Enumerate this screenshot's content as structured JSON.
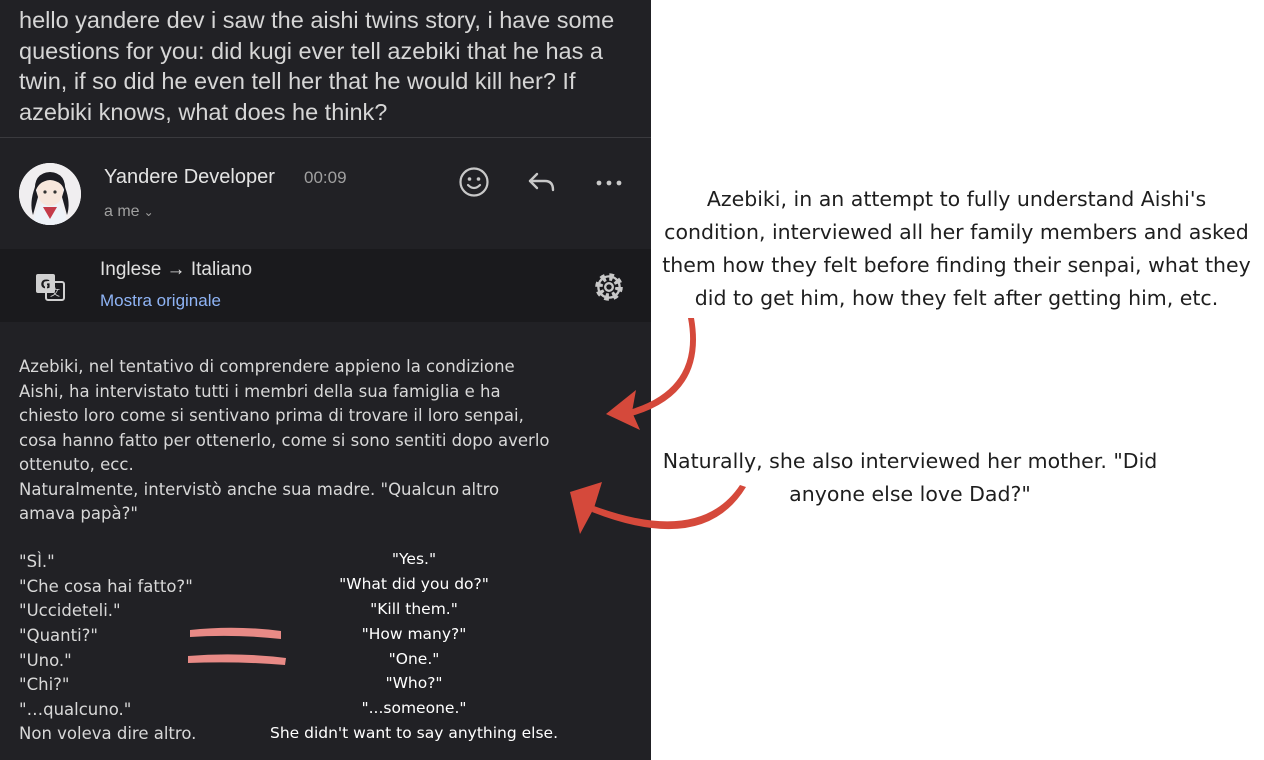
{
  "email": {
    "question": "hello yandere dev i saw the aishi twins story, i have some questions for you: did kugi ever tell azebiki that he has a twin, if so did he even tell her that he would kill her? If azebiki knows, what does he think?",
    "sender": "Yandere Developer",
    "time": "00:09",
    "recipient": "a me",
    "translation_bar": {
      "languages": "Inglese → Italiano",
      "show_original": "Mostra originale"
    },
    "body_paragraph": "Azebiki, nel tentativo di comprendere appieno la condizione\nAishi, ha intervistato tutti i membri della sua famiglia e ha\nchiesto loro come si sentivano prima di trovare il loro senpai,\ncosa hanno fatto per ottenerlo, come si sono sentiti dopo averlo\nottenuto, ecc.\nNaturalmente, intervistò anche sua madre. \"Qualcun altro\namava papà?\"",
    "dialogue_it": [
      "\"SÌ.\"",
      "\"Che cosa hai fatto?\"",
      "\"Uccideteli.\"",
      "\"Quanti?\"",
      "\"Uno.\"",
      "\"Chi?\"",
      "\"…qualcuno.\"",
      "Non voleva dire altro."
    ]
  },
  "overlay": {
    "dialogue_en": [
      "\"Yes.\"",
      "\"What did you do?\"",
      "\"Kill them.\"",
      "\"How many?\"",
      "\"One.\"",
      "\"Who?\"",
      "\"...someone.\"",
      "She didn't want to say anything else."
    ],
    "annotation_1": "Azebiki, in an attempt to fully understand Aishi's condition, interviewed all her family members and asked them how they felt before finding their senpai, what they did to get him, how they felt after getting him, etc.",
    "annotation_2": "Naturally, she also interviewed her mother. \"Did anyone else love Dad?\"",
    "arrow_color": "#d5493b",
    "highlight_color": "#e88a86"
  },
  "icons": [
    "emoji-icon",
    "reply-icon",
    "more-icon",
    "translate-icon",
    "gear-icon",
    "chevron-down-icon"
  ]
}
